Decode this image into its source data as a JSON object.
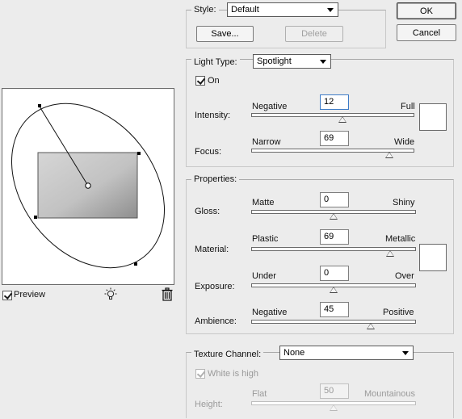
{
  "style": {
    "label": "Style:",
    "value": "Default",
    "save_label": "Save...",
    "delete_label": "Delete"
  },
  "dialog": {
    "ok_label": "OK",
    "cancel_label": "Cancel"
  },
  "light_type": {
    "label": "Light Type:",
    "value": "Spotlight",
    "on_label": "On",
    "on_checked": true,
    "intensity": {
      "label": "Intensity:",
      "min_label": "Negative",
      "max_label": "Full",
      "value": "12",
      "slider_fraction": 0.56
    },
    "focus": {
      "label": "Focus:",
      "min_label": "Narrow",
      "max_label": "Wide",
      "value": "69",
      "slider_fraction": 0.845
    },
    "color": "#ffffff"
  },
  "properties": {
    "title": "Properties:",
    "gloss": {
      "label": "Gloss:",
      "min_label": "Matte",
      "max_label": "Shiny",
      "value": "0",
      "slider_fraction": 0.5
    },
    "material": {
      "label": "Material:",
      "min_label": "Plastic",
      "max_label": "Metallic",
      "value": "69",
      "slider_fraction": 0.845
    },
    "exposure": {
      "label": "Exposure:",
      "min_label": "Under",
      "max_label": "Over",
      "value": "0",
      "slider_fraction": 0.5
    },
    "ambience": {
      "label": "Ambience:",
      "min_label": "Negative",
      "max_label": "Positive",
      "value": "45",
      "slider_fraction": 0.725
    },
    "color": "#ffffff"
  },
  "texture": {
    "label": "Texture Channel:",
    "value": "None",
    "white_is_high_label": "White is high",
    "white_is_high_checked": true,
    "height": {
      "label": "Height:",
      "min_label": "Flat",
      "max_label": "Mountainous",
      "value": "50",
      "slider_fraction": 0.5
    }
  },
  "preview": {
    "label": "Preview",
    "checked": true
  }
}
